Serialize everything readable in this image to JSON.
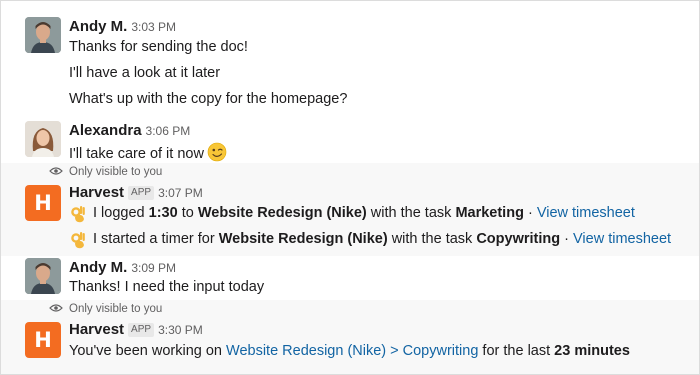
{
  "messages": [
    {
      "user": "Andy M.",
      "time": "3:03 PM",
      "lines": [
        "Thanks for sending the doc!",
        "I'll have a look at it later",
        "What's up with the copy for the homepage?"
      ]
    },
    {
      "user": "Alexandra",
      "time": "3:06 PM",
      "lines": [
        "I'll take care of it now"
      ],
      "emoji": "winking-face"
    },
    {
      "notice": "Only visible to you",
      "user": "Harvest",
      "badge": "APP",
      "time": "3:07 PM",
      "lines": [
        {
          "emoji": "ok-hand",
          "t1": "I logged ",
          "b1": "1:30",
          "t2": " to ",
          "b2": "Website Redesign (Nike)",
          "t3": " with the task ",
          "b3": "Marketing",
          "t4": " · ",
          "link": "View timesheet"
        },
        {
          "emoji": "ok-hand",
          "t1": "I started a timer for ",
          "b1": "Website Redesign (Nike)",
          "t2": " with the task ",
          "b2": "Copywriting",
          "t3": " · ",
          "link": "View timesheet"
        }
      ]
    },
    {
      "user": "Andy M.",
      "time": "3:09 PM",
      "lines": [
        "Thanks! I need the input today"
      ]
    },
    {
      "notice": "Only visible to you",
      "user": "Harvest",
      "badge": "APP",
      "time": "3:30 PM",
      "lines": [
        {
          "t1": "You've been working on ",
          "link": "Website Redesign (Nike) > Copywriting",
          "t2": " for the last ",
          "b1": "23 minutes"
        }
      ]
    }
  ],
  "harvest_logo_letter": "H",
  "colors": {
    "link": "#1264a3",
    "harvest_orange": "#f36c21",
    "highlight_bg": "#f8f8f8",
    "meta_text": "#616061"
  }
}
